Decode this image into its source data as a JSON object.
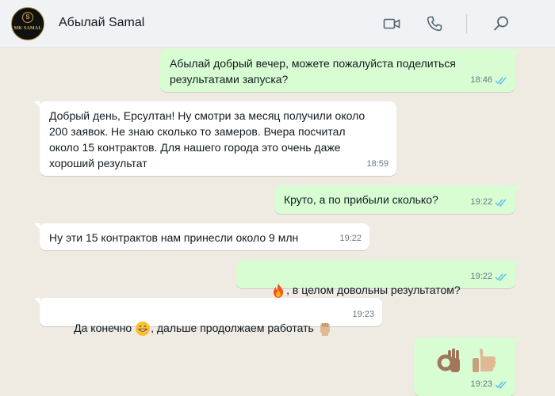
{
  "header": {
    "contact_name": "Абылай Samal",
    "avatar_text": "MK SAMAL",
    "avatar_ring_letter": "S",
    "icons": [
      "video-call-icon",
      "voice-call-icon",
      "search-icon"
    ]
  },
  "colors": {
    "outgoing_bubble": "#d9fdd3",
    "incoming_bubble": "#ffffff",
    "chat_background": "#efeae2",
    "read_ticks": "#53bdeb"
  },
  "messages": [
    {
      "direction": "out",
      "text": "Абылай добрый вечер, можете пожалуйста поделиться\nрезультатами запуска?",
      "time": "18:46",
      "status": "read"
    },
    {
      "direction": "in",
      "text": "Добрый день, Ерсултан! Ну смотри за месяц получили около\n200 заявок. Не знаю сколько то замеров. Вчера посчитал\nоколо 15 контрактов. Для нашего города это очень даже\nхороший результат",
      "time": "18:59"
    },
    {
      "direction": "out",
      "text": "Круто, а по прибыли сколько?",
      "time": "19:22",
      "status": "read"
    },
    {
      "direction": "in",
      "text": "Ну эти 15 контрактов нам принесли около 9 млн",
      "time": "19:22"
    },
    {
      "direction": "out",
      "text": ", в целом довольны результатом?",
      "emoji_before": "fire",
      "time": "19:22",
      "status": "read"
    },
    {
      "direction": "in",
      "text_before": "Да конечно ",
      "emoji_mid": "grinning-face",
      "text_after": ", дальше продолжаем работать ",
      "emoji_after": "raised-fist",
      "time": "19:23"
    },
    {
      "direction": "out",
      "emojis": [
        "ok-hand",
        "thumbs-up"
      ],
      "time": "19:23",
      "status": "read"
    }
  ]
}
